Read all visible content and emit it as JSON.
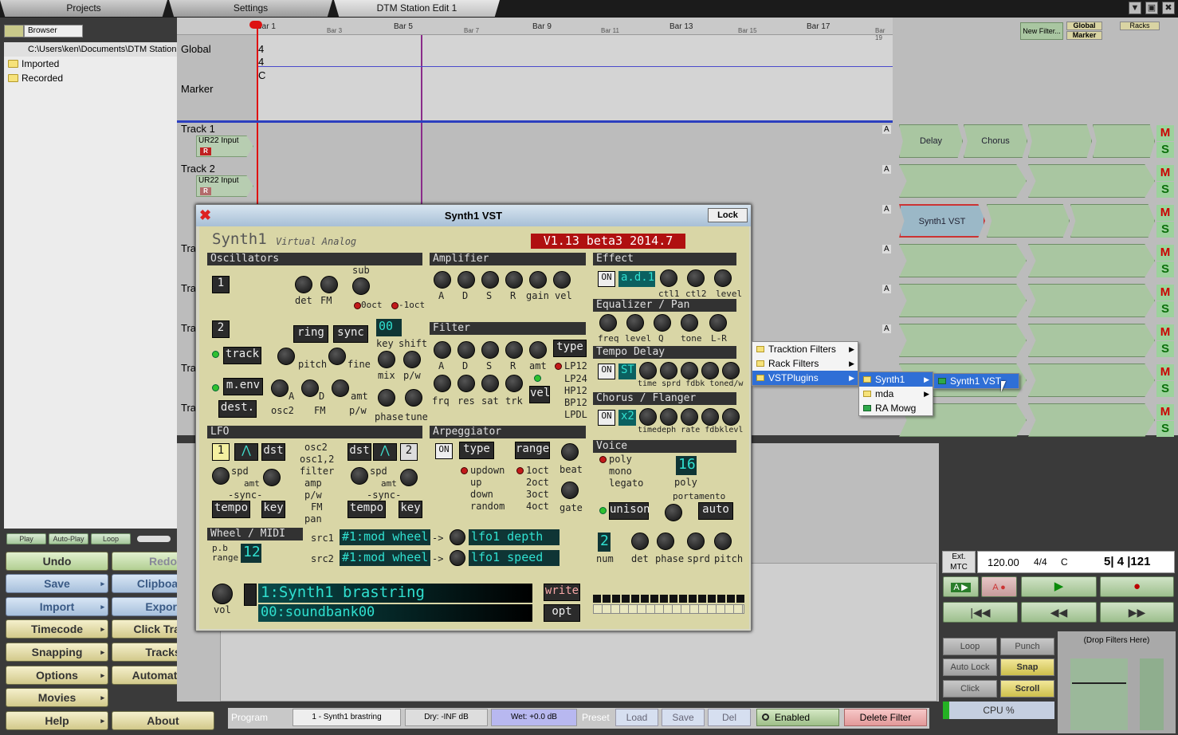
{
  "tabs": {
    "projects": "Projects",
    "settings": "Settings",
    "edit": "DTM Station Edit 1"
  },
  "window_controls": {
    "min": "▼",
    "max": "▣",
    "close": "✖"
  },
  "browser": {
    "mode": "Browser",
    "path": "C:\\Users\\ken\\Documents\\DTM Station",
    "folders": [
      "Imported",
      "Recorded"
    ],
    "play": "Play",
    "autoplay": "Auto-Play",
    "loop": "Loop"
  },
  "left_buttons": {
    "undo": "Undo",
    "redo": "Redo",
    "save": "Save",
    "clipboard": "Clipboard",
    "import": "Import",
    "export": "Export",
    "timecode": "Timecode",
    "click_track": "Click Track",
    "snapping": "Snapping",
    "tracks": "Tracks",
    "options": "Options",
    "automation": "Automation",
    "movies": "Movies",
    "help": "Help",
    "about": "About"
  },
  "ruler": {
    "bar1": "Bar 1",
    "bar3": "Bar 3",
    "bar5": "Bar 5",
    "bar7": "Bar 7",
    "bar9": "Bar 9",
    "bar11": "Bar 11",
    "bar13": "Bar 13",
    "bar15": "Bar 15",
    "bar17": "Bar 17",
    "bar19": "Bar 19"
  },
  "global": {
    "label": "Global",
    "num": "4",
    "den": "4",
    "key": "C"
  },
  "marker": {
    "label": "Marker"
  },
  "tracks": {
    "t1": "Track 1",
    "t2": "Track 2",
    "tr": "Tra",
    "input": "UR22 Input",
    "rec": "R"
  },
  "filters": {
    "new_filter": "New Filter...",
    "global": "Global",
    "marker": "Marker",
    "racks": "Racks",
    "delay": "Delay",
    "chorus": "Chorus",
    "synth": "Synth1 VST",
    "auto": "A",
    "m": "M",
    "s": "S"
  },
  "plugin": {
    "title": "Synth1 VST",
    "lock": "Lock"
  },
  "synth": {
    "brand": "Synth1",
    "sub": "Virtual Analog",
    "version": "V1.13 beta3 2014.7",
    "osc": "Oscillators",
    "amp": "Amplifier",
    "effect": "Effect",
    "eq": "Equalizer / Pan",
    "tempo_delay": "Tempo Delay",
    "chorus": "Chorus / Flanger",
    "filter": "Filter",
    "lfo": "LFO",
    "arp": "Arpeggiator",
    "voice": "Voice",
    "wheel": "Wheel / MIDI",
    "det": "det",
    "fm": "FM",
    "sub_lbl": "sub",
    "oct0": "0oct",
    "oct1": "-1oct",
    "ring": "ring",
    "sync": "sync",
    "track": "track",
    "pitch": "pitch",
    "fine": "fine",
    "key": "key",
    "shift": "shift",
    "mix": "mix",
    "pw": "p/w",
    "menv": "m.env",
    "dest": "dest.",
    "osc2": "osc2",
    "fm2": "FM",
    "pw2": "p/w",
    "a": "A",
    "d": "D",
    "s": "S",
    "r": "R",
    "amt": "amt",
    "gain": "gain",
    "vel": "vel",
    "phase": "phase",
    "tune": "tune",
    "type": "type",
    "frq": "frq",
    "res": "res",
    "sat": "sat",
    "trk": "trk",
    "lp12": "LP12",
    "lp24": "LP24",
    "hp12": "HP12",
    "bp12": "BP12",
    "lpdl": "LPDL",
    "filter_shift": "00",
    "on": "ON",
    "effect_type": "a.d.1",
    "ctl1": "ctl1",
    "ctl2": "ctl2",
    "level": "level",
    "freq": "freq",
    "q": "Q",
    "tone": "tone",
    "lr": "L-R",
    "st": "ST",
    "td_labels": "time sprd fdbk toned/w",
    "x2": "x2",
    "ch_labels": "timedeph rate fdbklevl",
    "lfo_dst": "dst",
    "lfo_osc2": "osc2",
    "lfo_osc12": "osc1,2",
    "lfo_filter": "filter",
    "lfo_amp": "amp",
    "lfo_pw": "p/w",
    "lfo_fm": "FM",
    "lfo_pan": "pan",
    "spd": "spd",
    "lfo_sync": "-sync-",
    "tempo": "tempo",
    "lfo1": "1",
    "lfo2": "2",
    "arp_type": "type",
    "range": "range",
    "updown": "updown",
    "up": "up",
    "down": "down",
    "random": "random",
    "oct1a": "1oct",
    "oct2": "2oct",
    "oct3": "3oct",
    "oct4": "4oct",
    "beat": "beat",
    "gate": "gate",
    "poly": "poly",
    "mono": "mono",
    "legato": "legato",
    "poly_num": "16",
    "poly_lbl": "poly",
    "portamento": "portamento",
    "auto": "auto",
    "unison": "unison",
    "num": "2",
    "num_lbl": "num",
    "v_det": "det",
    "v_phase": "phase",
    "v_sprd": "sprd",
    "v_pitch": "pitch",
    "pb": "p.b range",
    "pb_val": "12",
    "src1": "src1",
    "src2": "src2",
    "mod_wheel": "#1:mod wheel",
    "arrow": "->",
    "lfo1_depth": "lfo1 depth",
    "lfo1_speed": "lfo1 speed",
    "vol": "vol",
    "preset1": "1:Synth1 brastring",
    "preset2": "00:soundbank00",
    "write": "write",
    "opt": "opt"
  },
  "context_menu": {
    "tracktion": "Tracktion Filters",
    "rack": "Rack Filters",
    "vst": "VSTPlugins",
    "synth1": "Synth1",
    "mda": "mda",
    "ramowg": "RA Mowg",
    "synth1vst": "Synth1 VST"
  },
  "transport": {
    "ext": "Ext. MTC",
    "bpm": "120.00",
    "sig": "4/4",
    "key": "C",
    "pos": "5| 4 |121",
    "loop": "Loop",
    "punch": "Punch",
    "autolock": "Auto Lock",
    "snap": "Snap",
    "click": "Click",
    "scroll": "Scroll",
    "drop": "(Drop Filters Here)",
    "cpu": "CPU %"
  },
  "bottom": {
    "program": "Program",
    "prog_val": "1 - Synth1 brastring",
    "dry": "Dry: -INF dB",
    "wet": "Wet: +0.0 dB",
    "preset": "Preset",
    "load": "Load",
    "save": "Save",
    "del": "Del",
    "enabled": "Enabled",
    "delete": "Delete Filter"
  }
}
